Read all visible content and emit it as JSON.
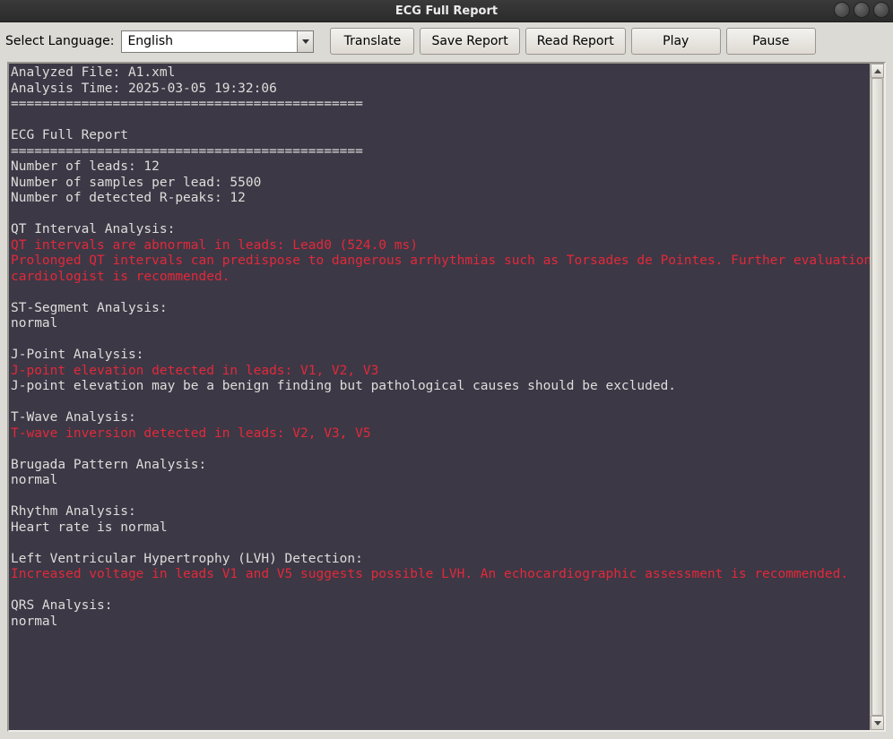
{
  "window": {
    "title": "ECG Full Report"
  },
  "toolbar": {
    "language_label": "Select Language:",
    "language_value": "English",
    "translate": "Translate",
    "save": "Save Report",
    "read": "Read Report",
    "play": "Play",
    "pause": "Pause"
  },
  "report": {
    "lines": [
      {
        "t": "Analyzed File: A1.xml"
      },
      {
        "t": "Analysis Time: 2025-03-05 19:32:06"
      },
      {
        "t": "============================================="
      },
      {
        "t": ""
      },
      {
        "t": "ECG Full Report"
      },
      {
        "t": "============================================="
      },
      {
        "t": "Number of leads: 12"
      },
      {
        "t": "Number of samples per lead: 5500"
      },
      {
        "t": "Number of detected R-peaks: 12"
      },
      {
        "t": ""
      },
      {
        "t": "QT Interval Analysis:"
      },
      {
        "t": "QT intervals are abnormal in leads: Lead0 (524.0 ms)",
        "warn": true
      },
      {
        "t": "Prolonged QT intervals can predispose to dangerous arrhythmias such as Torsades de Pointes. Further evaluation by a",
        "warn": true
      },
      {
        "t": "cardiologist is recommended.",
        "warn": true
      },
      {
        "t": ""
      },
      {
        "t": "ST-Segment Analysis:"
      },
      {
        "t": "normal"
      },
      {
        "t": ""
      },
      {
        "t": "J-Point Analysis:"
      },
      {
        "t": "J-point elevation detected in leads: V1, V2, V3",
        "warn": true
      },
      {
        "t": "J-point elevation may be a benign finding but pathological causes should be excluded."
      },
      {
        "t": ""
      },
      {
        "t": "T-Wave Analysis:"
      },
      {
        "t": "T-wave inversion detected in leads: V2, V3, V5",
        "warn": true
      },
      {
        "t": ""
      },
      {
        "t": "Brugada Pattern Analysis:"
      },
      {
        "t": "normal"
      },
      {
        "t": ""
      },
      {
        "t": "Rhythm Analysis:"
      },
      {
        "t": "Heart rate is normal"
      },
      {
        "t": ""
      },
      {
        "t": "Left Ventricular Hypertrophy (LVH) Detection:"
      },
      {
        "t": "Increased voltage in leads V1 and V5 suggests possible LVH. An echocardiographic assessment is recommended.",
        "warn": true
      },
      {
        "t": ""
      },
      {
        "t": "QRS Analysis:"
      },
      {
        "t": "normal"
      }
    ]
  }
}
